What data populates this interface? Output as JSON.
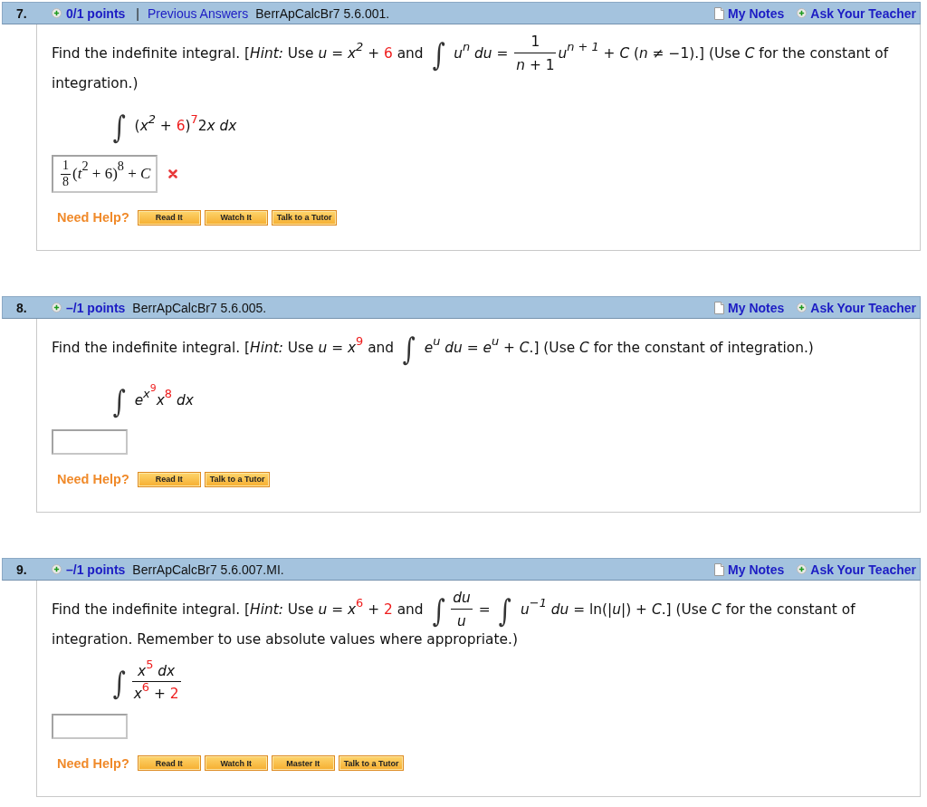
{
  "questions": [
    {
      "number": "7.",
      "points": "0/1 points",
      "separator": "|",
      "previous_answers": "Previous Answers",
      "code": "BerrApCalcBr7 5.6.001.",
      "my_notes": "My Notes",
      "ask_teacher": "Ask Your Teacher",
      "prompt": [
        [
          {
            "kind": "text",
            "text": "Find the indefinite integral. [*Hint:* Use *u* = *x*$^{2}$ + "
          },
          {
            "kind": "param",
            "text": "6"
          },
          {
            "kind": "text",
            "text": " and "
          },
          {
            "kind": "int",
            "text": "∫"
          },
          {
            "kind": "text",
            "text": " *u*$^{n}$ *du* = "
          },
          {
            "kind": "frac",
            "num": [
              {
                "kind": "text",
                "text": "1"
              }
            ],
            "den": [
              {
                "kind": "text",
                "text": "*n* + 1"
              }
            ]
          },
          {
            "kind": "text",
            "text": "*u*$^{n + 1}$ + *C* (*n* ≠ −1).] (Use *C* for the constant of"
          }
        ],
        [
          {
            "kind": "text",
            "text": "integration.)"
          }
        ]
      ],
      "expression": [
        {
          "kind": "int",
          "text": "∫"
        },
        {
          "kind": "text",
          "text": " (*x*$^{2}$ + "
        },
        {
          "kind": "param",
          "text": "6"
        },
        {
          "kind": "text",
          "text": ")"
        },
        {
          "kind": "param",
          "text": "$^{7}$"
        },
        {
          "kind": "text",
          "text": "2"
        },
        {
          "kind": "text",
          "text": "*x* *dx*"
        }
      ],
      "answer": {
        "value": [
          {
            "kind": "frac",
            "num": [
              {
                "kind": "text",
                "text": "1"
              }
            ],
            "den": [
              {
                "kind": "text",
                "text": "8"
              }
            ]
          },
          {
            "kind": "text",
            "text": "(*t*$^{2}$ + 6)$^{8}$ + *C*"
          }
        ],
        "correct": false
      },
      "help_label": "Need Help?",
      "help_buttons": [
        "Read It",
        "Watch It",
        "Talk to a Tutor"
      ]
    },
    {
      "number": "8.",
      "points": "–/1 points",
      "code": "BerrApCalcBr7 5.6.005.",
      "my_notes": "My Notes",
      "ask_teacher": "Ask Your Teacher",
      "prompt": [
        [
          {
            "kind": "text",
            "text": "Find the indefinite integral. [*Hint:* Use *u* = *x*"
          },
          {
            "kind": "param",
            "text": "$^{9}$"
          },
          {
            "kind": "text",
            "text": " and "
          },
          {
            "kind": "int",
            "text": "∫"
          },
          {
            "kind": "text",
            "text": " *e*$^{u}$ *du* = *e*$^{u}$ + *C*.] (Use *C* for the constant of integration.)"
          }
        ]
      ],
      "expression": [
        {
          "kind": "int",
          "text": "∫"
        },
        {
          "kind": "text",
          "text": " *e*"
        },
        {
          "kind": "sup",
          "children": [
            {
              "kind": "text",
              "text": "*x*"
            },
            {
              "kind": "param",
              "text": "$^{9}$"
            }
          ]
        },
        {
          "kind": "text",
          "text": "*x*"
        },
        {
          "kind": "param",
          "text": "$^{8}$"
        },
        {
          "kind": "text",
          "text": " *dx*"
        }
      ],
      "help_label": "Need Help?",
      "help_buttons": [
        "Read It",
        "Talk to a Tutor"
      ]
    },
    {
      "number": "9.",
      "points": "–/1 points",
      "code": "BerrApCalcBr7 5.6.007.MI.",
      "my_notes": "My Notes",
      "ask_teacher": "Ask Your Teacher",
      "prompt": [
        [
          {
            "kind": "text",
            "text": "Find the indefinite integral. [*Hint:* Use *u* = *x*"
          },
          {
            "kind": "param",
            "text": "$^{6}$"
          },
          {
            "kind": "text",
            "text": " + "
          },
          {
            "kind": "param",
            "text": "2"
          },
          {
            "kind": "text",
            "text": " and "
          },
          {
            "kind": "int",
            "text": "∫"
          },
          {
            "kind": "frac",
            "num": [
              {
                "kind": "text",
                "text": "*du*"
              }
            ],
            "den": [
              {
                "kind": "text",
                "text": "*u*"
              }
            ]
          },
          {
            "kind": "text",
            "text": " = "
          },
          {
            "kind": "int",
            "text": "∫"
          },
          {
            "kind": "text",
            "text": " *u*$^{−1}$ *du* = ln(|*u*|) + *C*.] (Use *C* for the constant of"
          }
        ],
        [
          {
            "kind": "text",
            "text": "integration. Remember to use absolute values where appropriate.)"
          }
        ]
      ],
      "expression": [
        {
          "kind": "int",
          "text": "∫"
        },
        {
          "kind": "frac",
          "num": [
            {
              "kind": "text",
              "text": "*x*"
            },
            {
              "kind": "param",
              "text": "$^{5}$"
            },
            {
              "kind": "text",
              "text": " *dx*"
            }
          ],
          "den": [
            {
              "kind": "text",
              "text": "*x*"
            },
            {
              "kind": "param",
              "text": "$^{6}$"
            },
            {
              "kind": "text",
              "text": " + "
            },
            {
              "kind": "param",
              "text": "2"
            }
          ]
        }
      ],
      "help_label": "Need Help?",
      "help_buttons": [
        "Read It",
        "Watch It",
        "Master It",
        "Talk to a Tutor"
      ]
    }
  ]
}
